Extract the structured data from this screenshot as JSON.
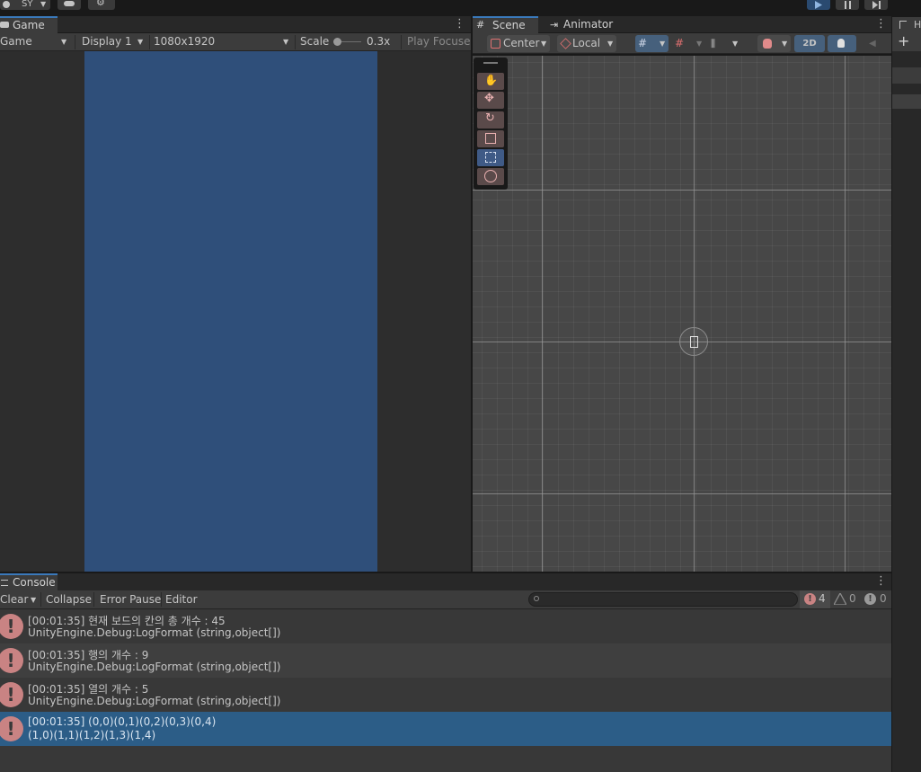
{
  "toolbar": {
    "account_label": "SY",
    "cloud_icon": "cloud-icon",
    "settings_icon": "gear-icon",
    "play_icon": "play-icon",
    "pause_icon": "pause-icon",
    "step_icon": "step-icon"
  },
  "game": {
    "tab_label": "Game",
    "view_select": "Game",
    "display_select": "Display 1",
    "resolution_select": "1080x1920",
    "scale_label": "Scale",
    "scale_value": "0.3x",
    "scale_level": 0.1,
    "play_focused": "Play Focuse",
    "canvas_color": "#2f4f7a"
  },
  "scene": {
    "tabs": [
      {
        "label": "Scene",
        "icon": "grid-icon"
      },
      {
        "label": "Animator",
        "icon": "animator-icon"
      }
    ],
    "pivot_label": "Center",
    "space_label": "Local",
    "mode_2d": "2D",
    "tools": [
      "hand-tool-icon",
      "move-tool-icon",
      "rotate-tool-icon",
      "scale-tool-icon",
      "rect-tool-icon",
      "transform-tool-icon"
    ],
    "selected_tool": "rect-tool-icon"
  },
  "right_panel": {
    "tab_label": "H",
    "add_icon": "plus-icon"
  },
  "console": {
    "tab_label": "Console",
    "clear_label": "Clear",
    "collapse_label": "Collapse",
    "error_pause_label": "Error Pause",
    "editor_label": "Editor",
    "search_placeholder": "",
    "error_count": "4",
    "warning_count": "0",
    "info_count": "0",
    "entries": [
      {
        "line1": "[00:01:35] 현재 보드의 칸의 총 개수 : 45",
        "line2": "UnityEngine.Debug:LogFormat (string,object[])"
      },
      {
        "line1": "[00:01:35] 행의 개수 : 9",
        "line2": "UnityEngine.Debug:LogFormat (string,object[])"
      },
      {
        "line1": "[00:01:35] 열의 개수 : 5",
        "line2": "UnityEngine.Debug:LogFormat (string,object[])"
      },
      {
        "line1": "[00:01:35] (0,0)(0,1)(0,2)(0,3)(0,4)",
        "line2": "(1,0)(1,1)(1,2)(1,3)(1,4)"
      }
    ],
    "error_icon_color": "#c98383",
    "selected_row_color": "#2c5d87"
  }
}
